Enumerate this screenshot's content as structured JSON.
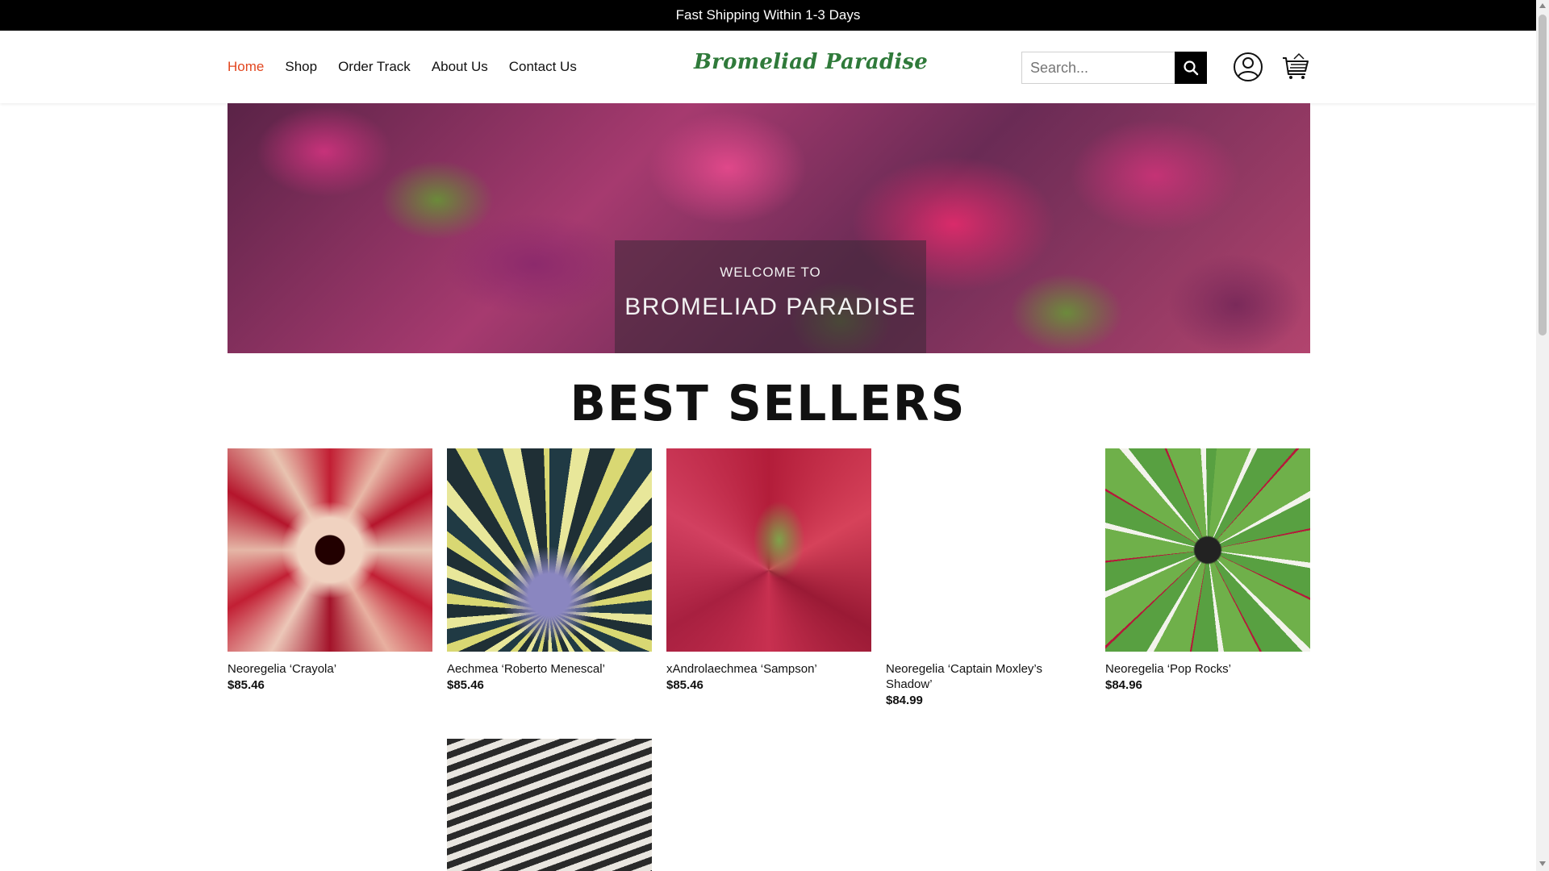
{
  "topbar": {
    "text": "Fast Shipping Within 1-3 Days"
  },
  "nav": {
    "items": [
      {
        "label": "Home",
        "active": true
      },
      {
        "label": "Shop"
      },
      {
        "label": "Order Track"
      },
      {
        "label": "About Us"
      },
      {
        "label": "Contact Us"
      }
    ]
  },
  "brand": {
    "logo_text": "Bromeliad Paradise",
    "accent_color": "#e2461f",
    "logo_color": "#2f7a3a"
  },
  "search": {
    "placeholder": "Search..."
  },
  "icons": {
    "search": "search-icon",
    "account": "user-icon",
    "cart": "cart-icon"
  },
  "hero": {
    "subtitle": "WELCOME TO",
    "title": "BROMELIAD PARADISE"
  },
  "section": {
    "title": "BEST SELLERS"
  },
  "products": [
    {
      "name": "Neoregelia ‘Crayola’",
      "price": "$85.46"
    },
    {
      "name": "Aechmea ‘Roberto Menescal’",
      "price": "$85.46"
    },
    {
      "name": "xAndrolaechmea ‘Sampson’",
      "price": "$85.46"
    },
    {
      "name": "Neoregelia ‘Captain Moxley’s Shadow’",
      "price": "$84.99"
    },
    {
      "name": "Neoregelia ‘Pop Rocks’",
      "price": "$84.96"
    },
    {
      "name": "",
      "price": ""
    }
  ]
}
